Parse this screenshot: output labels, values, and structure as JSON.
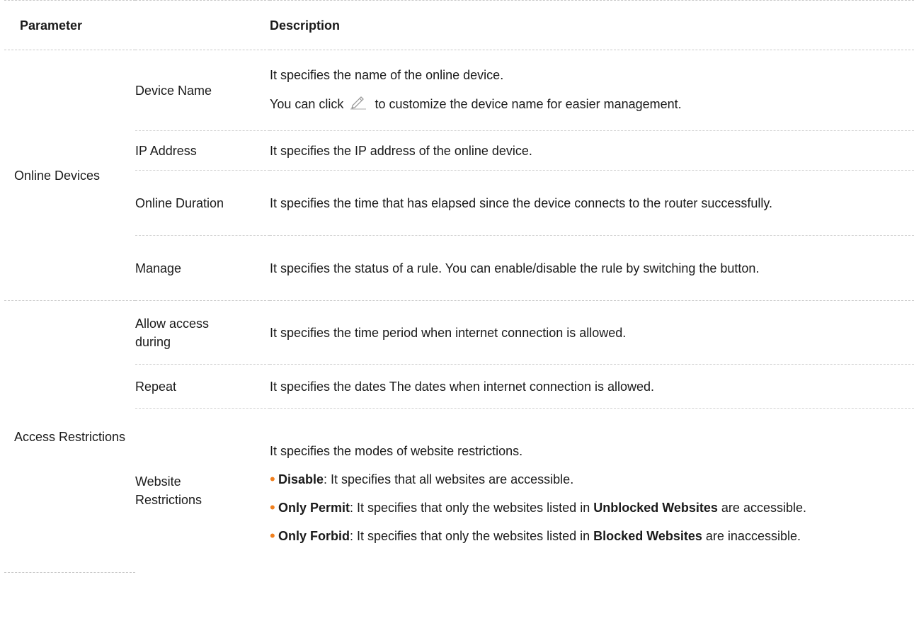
{
  "table": {
    "headers": {
      "parameter": "Parameter",
      "description": "Description"
    },
    "online": {
      "group_label": "Online Devices",
      "device_name": {
        "label": "Device Name",
        "line1": "It specifies the name of the online device.",
        "line2_pre": "You can click",
        "line2_post": "to customize the device name for easier management.",
        "icon": "pencil-edit-icon"
      },
      "ip_address": {
        "label": "IP Address",
        "desc": "It specifies the IP address of the online device."
      },
      "online_duration": {
        "label": "Online Duration",
        "desc": "It specifies the time that has elapsed since the device connects to the router successfully."
      },
      "manage": {
        "label": "Manage",
        "desc": "It specifies the status of a rule. You can enable/disable the rule by switching the button."
      }
    },
    "access": {
      "group_label": "Access Restrictions",
      "allow_access": {
        "label": "Allow access during",
        "desc": "It specifies the time period when internet connection is allowed."
      },
      "repeat": {
        "label": "Repeat",
        "desc": "It specifies the dates The dates when internet connection is allowed."
      },
      "website_restrictions": {
        "label": "Website Restrictions",
        "intro": "It specifies the modes of website restrictions.",
        "disable": {
          "term": "Disable",
          "text": ": It specifies that all websites are accessible."
        },
        "only_permit": {
          "term": "Only Permit",
          "text1": ": It specifies that only the websites listed in ",
          "ref": "Unblocked Websites",
          "text2": " are accessible."
        },
        "only_forbid": {
          "term": "Only Forbid",
          "text1": ": It specifies that only the websites listed in ",
          "ref": "Blocked Websites",
          "text2": " are inaccessible."
        }
      }
    },
    "bullet_color": "#f07f1d"
  }
}
